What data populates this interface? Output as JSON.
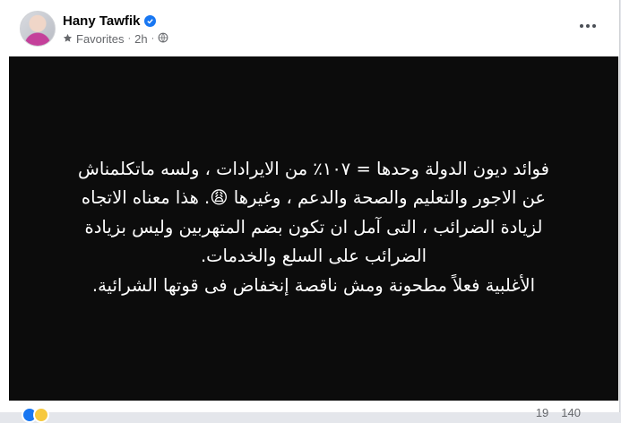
{
  "post": {
    "author": "Hany Tawfik",
    "audience": "Favorites",
    "time": "2h",
    "text": "فوائد ديون الدولة وحدها = ١٠٧٪ من الايرادات ، ولسه ماتكلمناش\nعن الاجور والتعليم والصحة والدعم ، وغيرها 😩. هذا معناه الاتجاه\nلزيادة الضرائب ، التى آمل ان تكون بضم المتهربين وليس بزيادة\nالضرائب على السلع والخدمات.\nالأغلبية فعلاً مطحونة ومش ناقصة إنخفاض فى قوتها الشرائية.",
    "comments_count": "19",
    "shares_count": "140"
  },
  "icons": {
    "verified": "verified-badge-icon",
    "audience": "star-icon",
    "privacy": "globe-icon",
    "more": "more-options-icon",
    "reactions": [
      "like-reaction-icon",
      "haha-reaction-icon"
    ]
  },
  "colors": {
    "accent": "#1877f2",
    "media_background": "#0c0c0c",
    "secondary_text": "#65676b"
  }
}
